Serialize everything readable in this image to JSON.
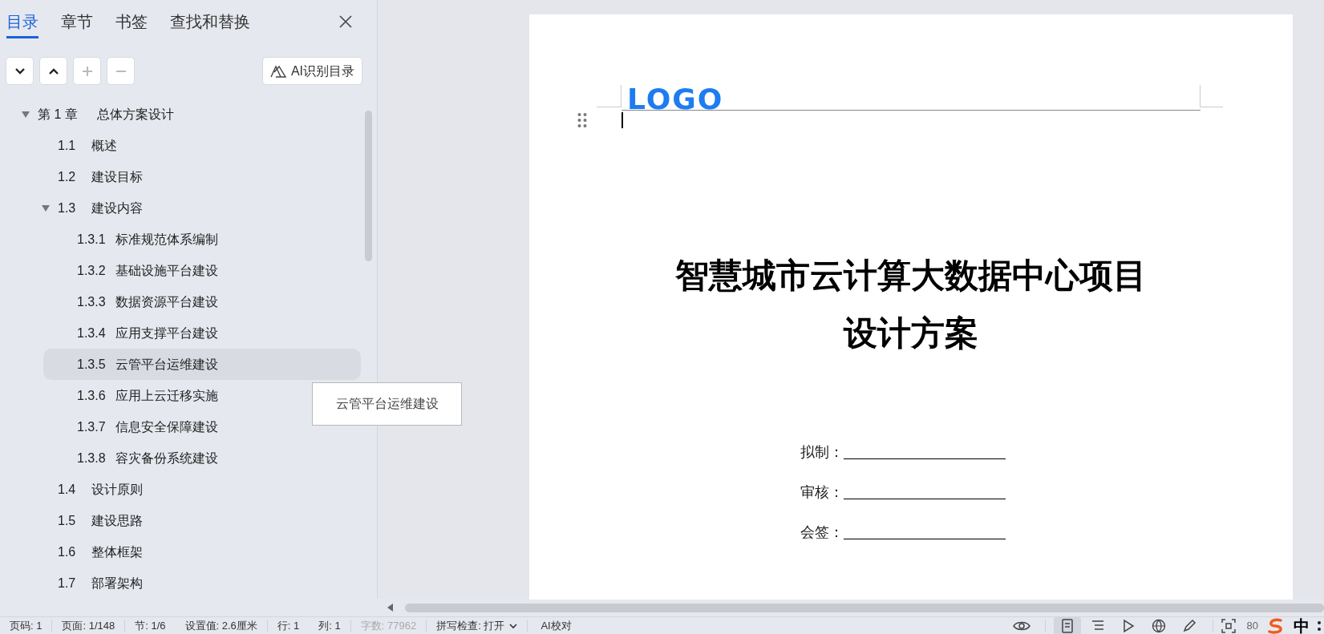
{
  "sidebar": {
    "tabs": [
      {
        "label": "目录",
        "selected": true
      },
      {
        "label": "章节",
        "selected": false
      },
      {
        "label": "书签",
        "selected": false
      },
      {
        "label": "查找和替换",
        "selected": false
      }
    ],
    "tool_buttons": [
      {
        "kind": "down",
        "disabled": false
      },
      {
        "kind": "up",
        "disabled": false
      },
      {
        "kind": "plus",
        "disabled": true
      },
      {
        "kind": "minus",
        "disabled": true
      }
    ],
    "ai_button": "AI识别目录",
    "toc": [
      {
        "number": "第 1 章",
        "title": "总体方案设计",
        "expanded": true,
        "selected": false,
        "children": [
          {
            "number": "1.1",
            "title": "概述",
            "selected": false
          },
          {
            "number": "1.2",
            "title": "建设目标",
            "selected": false
          },
          {
            "number": "1.3",
            "title": "建设内容",
            "expanded": true,
            "selected": false,
            "children": [
              {
                "number": "1.3.1",
                "title": "标准规范体系编制",
                "selected": false
              },
              {
                "number": "1.3.2",
                "title": "基础设施平台建设",
                "selected": false
              },
              {
                "number": "1.3.3",
                "title": "数据资源平台建设",
                "selected": false
              },
              {
                "number": "1.3.4",
                "title": "应用支撑平台建设",
                "selected": false
              },
              {
                "number": "1.3.5",
                "title": "云管平台运维建设",
                "selected": true
              },
              {
                "number": "1.3.6",
                "title": "应用上云迁移实施",
                "selected": false
              },
              {
                "number": "1.3.7",
                "title": "信息安全保障建设",
                "selected": false
              },
              {
                "number": "1.3.8",
                "title": "容灾备份系统建设",
                "selected": false
              }
            ]
          },
          {
            "number": "1.4",
            "title": "设计原则",
            "selected": false
          },
          {
            "number": "1.5",
            "title": "建设思路",
            "selected": false
          },
          {
            "number": "1.6",
            "title": "整体框架",
            "selected": false
          },
          {
            "number": "1.7",
            "title": "部署架构",
            "selected": false
          }
        ]
      }
    ],
    "tooltip": "云管平台运维建设"
  },
  "document": {
    "logo": "LOGO",
    "title_lines": [
      "智慧城市云计算大数据中心项目",
      "设计方案"
    ],
    "signatures": [
      {
        "label": "拟制："
      },
      {
        "label": "审核："
      },
      {
        "label": "会签："
      }
    ]
  },
  "status_bar": {
    "items": [
      {
        "text": "页码: 1",
        "disabled": false
      },
      {
        "text": "页面: 1/148",
        "disabled": false
      },
      {
        "text": "节: 1/6",
        "disabled": false
      },
      {
        "text": "设置值: 2.6厘米",
        "disabled": false
      },
      {
        "text": "行: 1",
        "disabled": false
      },
      {
        "text": "列: 1",
        "disabled": false
      },
      {
        "text": "字数: 77962",
        "disabled": true
      }
    ],
    "spell_check": "拼写检查: 打开",
    "ai_proofread": "AI校对",
    "view_modes": [
      {
        "kind": "page",
        "selected": true
      },
      {
        "kind": "outline",
        "selected": false
      },
      {
        "kind": "play",
        "selected": false
      },
      {
        "kind": "web",
        "selected": false
      },
      {
        "kind": "pen",
        "selected": false
      }
    ],
    "zoom": "80",
    "ime": "中"
  }
}
